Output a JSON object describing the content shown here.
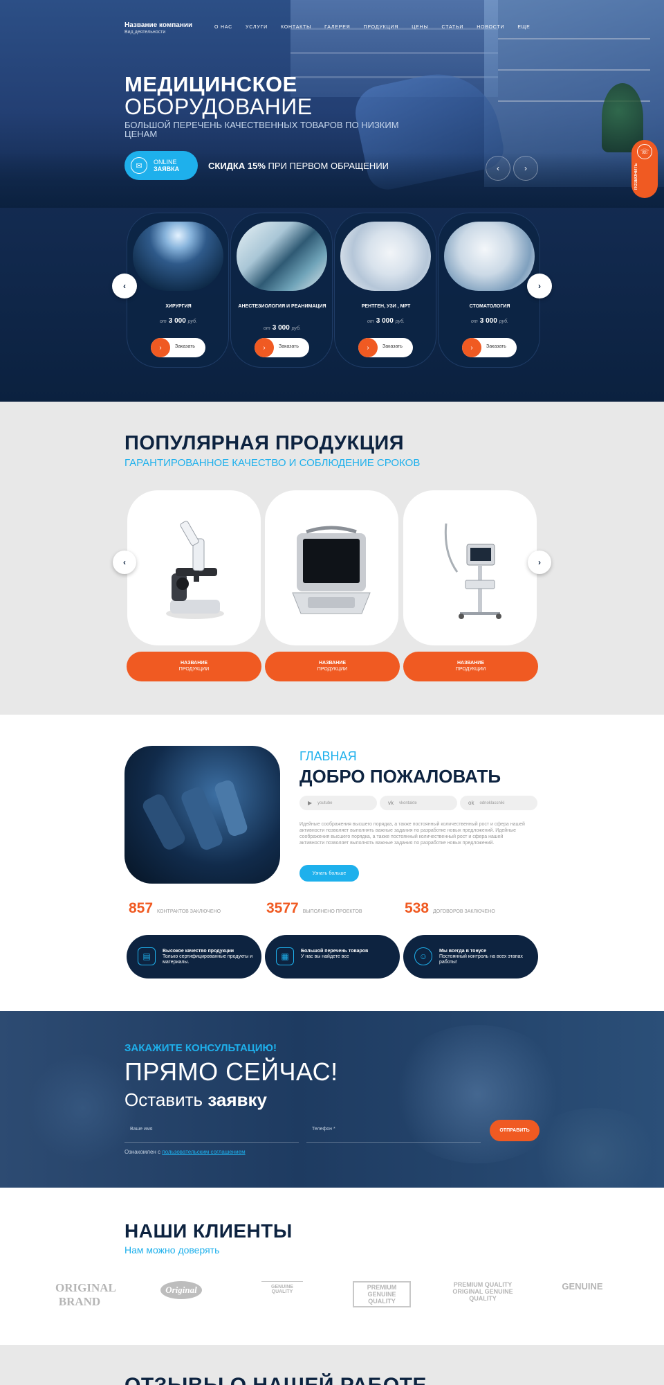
{
  "header": {
    "company_name": "Название компании",
    "company_desc": "Вид деятельности",
    "nav": [
      "О НАС",
      "УСЛУГИ",
      "КОНТАКТЫ",
      "ГАЛЕРЕЯ",
      "ПРОДУКЦИЯ",
      "ЦЕНЫ",
      "СТАТЬИ",
      "НОВОСТИ",
      "ЕЩЕ"
    ]
  },
  "hero": {
    "title_bold": "МЕДИЦИНСКОЕ",
    "title_light": "ОБОРУДОВАНИЕ",
    "subtitle": "БОЛЬШОЙ ПЕРЕЧЕНЬ КАЧЕСТВЕННЫХ ТОВАРОВ ПО НИЗКИМ ЦЕНАМ",
    "online_top": "ONLINE",
    "online_bottom": "ЗАЯВКА",
    "discount_bold": "СКИДКА 15%",
    "discount_rest": "ПРИ ПЕРВОМ ОБРАЩЕНИИ",
    "callback_label": "ПОЗВОНИТЬ"
  },
  "services": [
    {
      "title": "ХИРУРГИЯ",
      "price_from": "от",
      "price": "3 000",
      "currency": "руб.",
      "order": "Заказать"
    },
    {
      "title": "АНЕСТЕЗИОЛОГИЯ И РЕАНИМАЦИЯ",
      "price_from": "от",
      "price": "3 000",
      "currency": "руб.",
      "order": "Заказать"
    },
    {
      "title": "РЕНТГЕН, УЗИ , МРТ",
      "price_from": "от",
      "price": "3 000",
      "currency": "руб.",
      "order": "Заказать"
    },
    {
      "title": "СТОМАТОЛОГИЯ",
      "price_from": "от",
      "price": "3 000",
      "currency": "руб.",
      "order": "Заказать"
    }
  ],
  "popular": {
    "title": "ПОПУЛЯРНАЯ ПРОДУКЦИЯ",
    "subtitle": "ГАРАНТИРОВАННОЕ КАЧЕСТВО И СОБЛЮДЕНИЕ СРОКОВ",
    "products": [
      {
        "name_top": "НАЗВАНИЕ",
        "name_bottom": "ПРОДУКЦИИ",
        "icon": "microscope"
      },
      {
        "name_top": "НАЗВАНИЕ",
        "name_bottom": "ПРОДУКЦИИ",
        "icon": "ultrasound-scanner"
      },
      {
        "name_top": "НАЗВАНИЕ",
        "name_bottom": "ПРОДУКЦИИ",
        "icon": "ventilator-cart"
      }
    ]
  },
  "welcome": {
    "kicker": "ГЛАВНАЯ",
    "title": "ДОБРО ПОЖАЛОВАТЬ",
    "socials": [
      "youtube",
      "vkontakte",
      "odnoklassniki"
    ],
    "text": "Идейные соображения высшего порядка, а также постоянный количественный рост и сфера нашей активности позволяет выполнять важные задания по разработке новых предложений. Идейные соображения высшего порядка, а также постоянный количественный рост и сфера нашей активности позволяет выполнять важные задания по разработке новых предложений.",
    "more_button": "Узнать больше",
    "stats": [
      {
        "value": "857",
        "label": "КОНТРАКТОВ ЗАКЛЮЧЕНО"
      },
      {
        "value": "3577",
        "label": "ВЫПОЛНЕНО ПРОЕКТОВ"
      },
      {
        "value": "538",
        "label": "ДОГОВОРОВ ЗАКЛЮЧЕНО"
      }
    ],
    "features": [
      {
        "title": "Высокое качество продукции",
        "text": "Только сертифицированные продукты и материалы."
      },
      {
        "title": "Большой перечень товаров",
        "text": "У нас вы найдете все"
      },
      {
        "title": "Мы всегда в тонусе",
        "text": "Постоянный контроль на всех этапах работы!"
      }
    ]
  },
  "consult": {
    "kicker": "ЗАКАЖИТЕ КОНСУЛЬТАЦИЮ!",
    "headline": "ПРЯМО СЕЙЧАС!",
    "line_light": "Оставить",
    "line_bold": "заявку",
    "name_placeholder": "Ваше имя",
    "phone_placeholder": "Телефон *",
    "send_button": "ОТПРАВИТЬ",
    "agree_text": "Ознакомлен с",
    "agree_link": "пользовательским соглашением"
  },
  "clients": {
    "title": "НАШИ КЛИЕНТЫ",
    "subtitle": "Нам можно доверять",
    "logos": [
      "ORIGINAL BRAND",
      "Original",
      "GENUINE QUALITY",
      "PREMIUM GENUINE QUALITY",
      "PREMIUM QUALITY ORIGINAL GENUINE QUALITY",
      "GENUINE"
    ]
  },
  "reviews": {
    "title": "ОТЗЫВЫ О НАШЕЙ РАБОТЕ"
  },
  "colors": {
    "accent_orange": "#f05a22",
    "accent_blue": "#1eb0ec",
    "navy": "#0d2340"
  }
}
